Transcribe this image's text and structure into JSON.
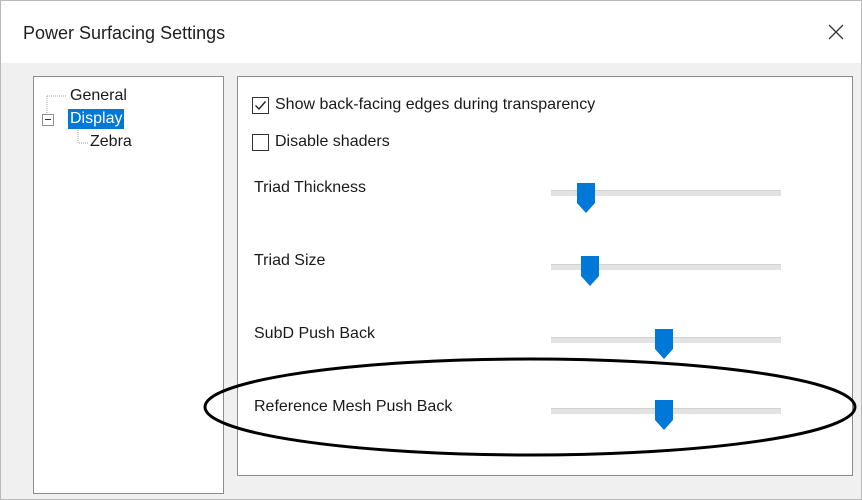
{
  "window": {
    "title": "Power Surfacing Settings"
  },
  "tree": {
    "items": [
      {
        "label": "General",
        "selected": false
      },
      {
        "label": "Display",
        "selected": true,
        "expanded": true
      },
      {
        "label": "Zebra",
        "selected": false
      }
    ]
  },
  "display": {
    "checkboxes": [
      {
        "label": "Show back-facing edges during transparency",
        "checked": true
      },
      {
        "label": "Disable shaders",
        "checked": false
      }
    ],
    "sliders": [
      {
        "label": "Triad Thickness",
        "value": 0.15
      },
      {
        "label": "Triad Size",
        "value": 0.17
      },
      {
        "label": "SubD Push Back",
        "value": 0.49
      },
      {
        "label": "Reference Mesh Push Back",
        "value": 0.49
      }
    ]
  },
  "colors": {
    "accent": "#0078d7",
    "annotation": "#000000"
  },
  "icons": {
    "close": "close-icon",
    "expander": "minus-icon",
    "check": "checkmark-icon",
    "thumb": "slider-thumb-icon"
  }
}
